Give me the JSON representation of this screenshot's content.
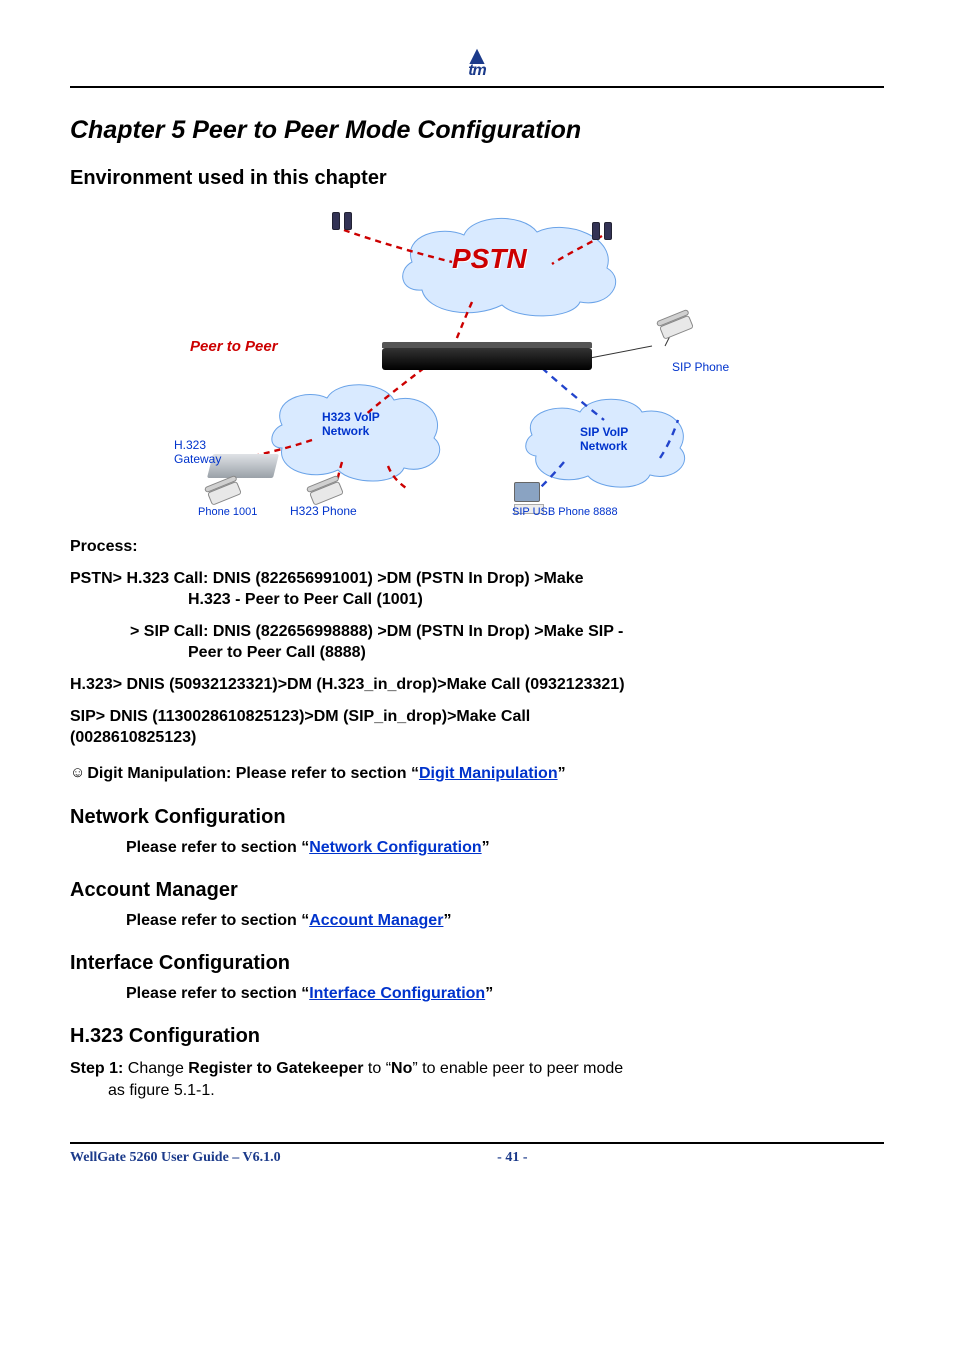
{
  "logo": {
    "brand": "tm"
  },
  "chapter_title": "Chapter 5 Peer to Peer Mode Configuration",
  "section_env": "Environment used in this chapter",
  "diagram": {
    "peer_to_peer": "Peer to Peer",
    "pstn": "PSTN",
    "h323_voip": "H323 VoIP",
    "h323_voip_line2": "Network",
    "sip_voip": "SIP VoIP",
    "sip_voip_line2": "Network",
    "h323_gateway": "H.323",
    "h323_gateway2": "Gateway",
    "phone1001": "Phone 1001",
    "h323_phone": "H323 Phone",
    "sip_usb": "SIP USB Phone 8888",
    "sip_phone": "SIP Phone"
  },
  "process": {
    "label": "Process:",
    "line1": "PSTN> H.323 Call: DNIS (822656991001) >DM (PSTN In Drop) >Make",
    "line1b": "H.323 - Peer to Peer Call (1001)",
    "line2": "> SIP Call: DNIS (822656998888) >DM (PSTN In Drop) >Make SIP -",
    "line2b": "Peer to Peer Call (8888)",
    "line3": "H.323> DNIS (50932123321)>DM (H.323_in_drop)>Make Call (0932123321)",
    "line4a": "SIP> DNIS (1130028610825123)>DM (SIP_in_drop)>Make Call",
    "line4b": "(0028610825123)",
    "dm_prefix": "Digit Manipulation: Please refer to section “",
    "dm_link": "Digit Manipulation",
    "dm_suffix": "”"
  },
  "network_cfg": {
    "title": "Network Configuration",
    "prefix": "Please refer to section “",
    "link": "Network Configuration",
    "suffix": "”"
  },
  "account_mgr": {
    "title": "Account Manager",
    "prefix": "Please refer to section “",
    "link": "Account Manager",
    "suffix": "”"
  },
  "interface_cfg": {
    "title": "Interface Configuration",
    "prefix": "Please refer to section “",
    "link": "Interface Configuration",
    "suffix": "”"
  },
  "h323_cfg": {
    "title": "H.323 Configuration",
    "step_label": "Step 1:",
    "text_a": " Change ",
    "reg_gk": "Register to Gatekeeper",
    "text_b": " to “",
    "no": "No",
    "text_c": "” to enable peer to peer mode",
    "cont": "as figure 5.1-1."
  },
  "footer": {
    "left": "WellGate 5260 User Guide – V6.1.0",
    "page": "- 41 -"
  }
}
